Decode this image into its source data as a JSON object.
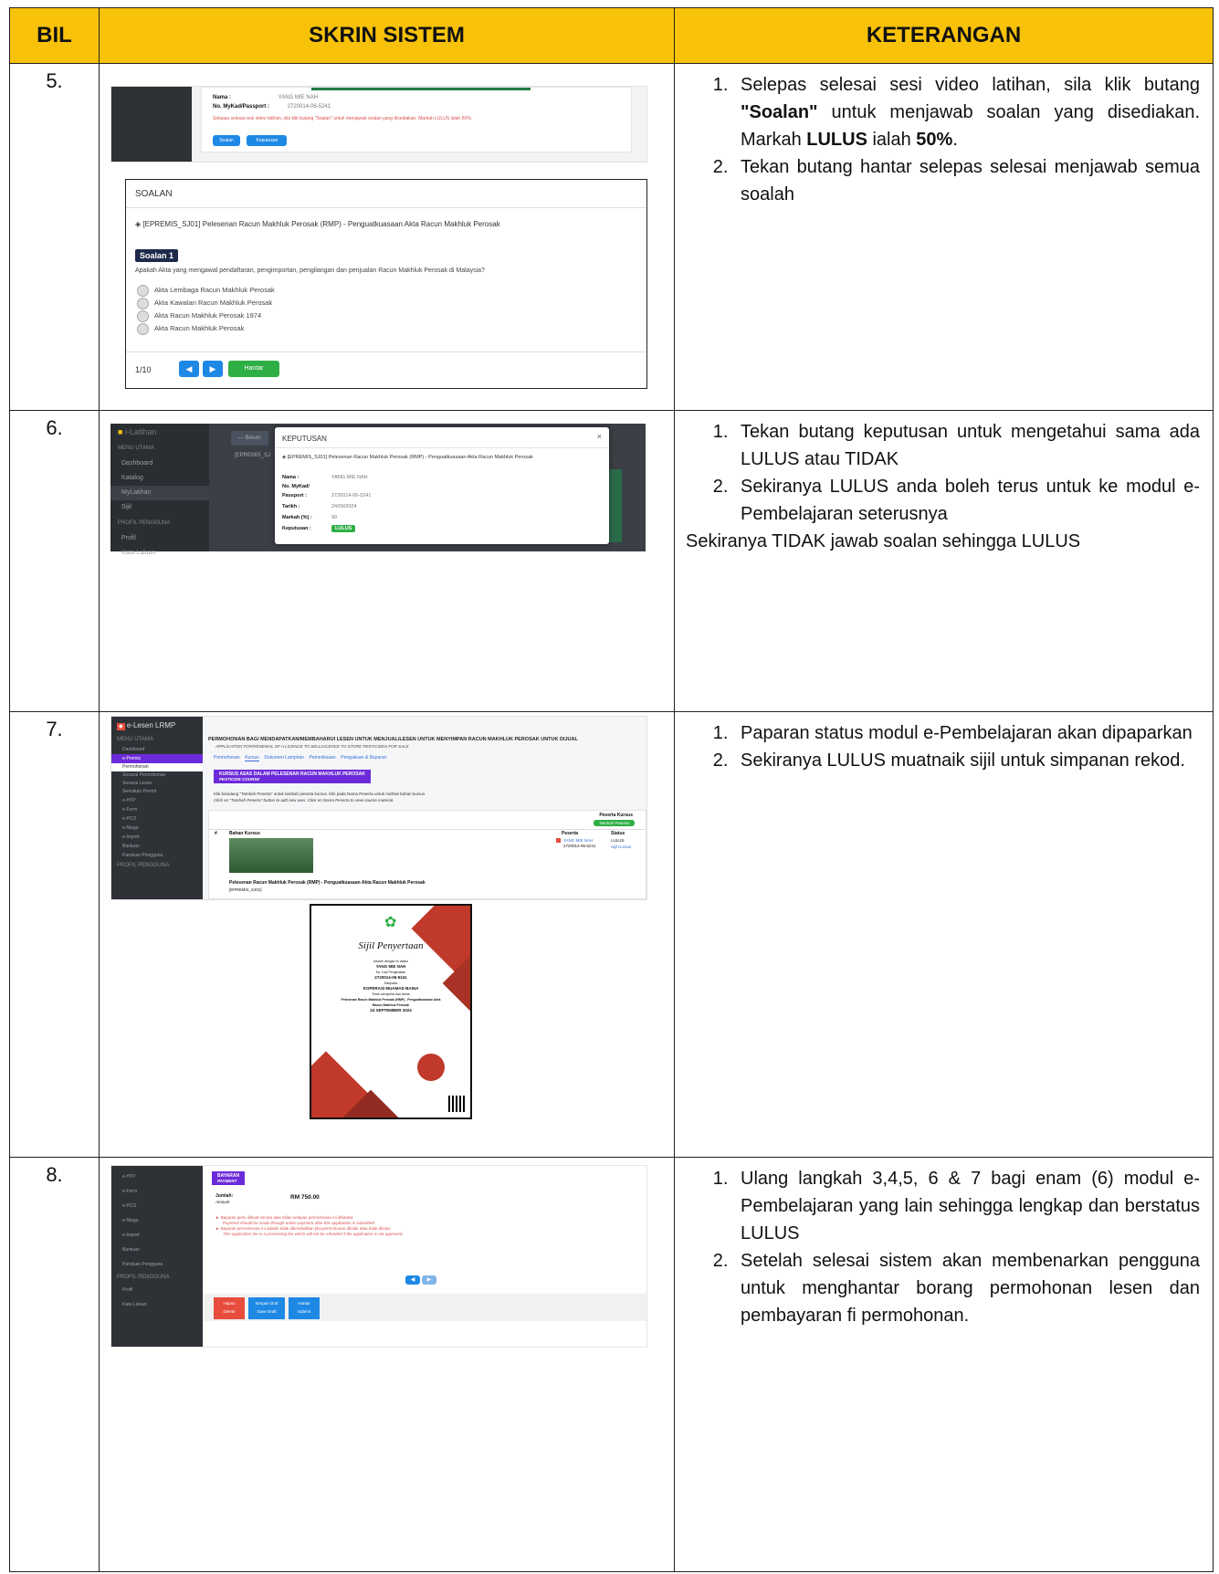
{
  "headers": {
    "bil": "BIL",
    "skrin": "SKRIN SISTEM",
    "keterangan": "KETERANGAN"
  },
  "rows": [
    {
      "bil": "5.",
      "items": [
        {
          "pre": "Selepas selesai sesi video latihan, sila klik butang ",
          "bold": "\"Soalan\"",
          "post": " untuk menjawab soalan yang disediakan. Markah ",
          "bold2": "LULUS",
          "post2": " ialah ",
          "bold3": "50%",
          "post3": "."
        },
        {
          "text": "Tekan butang hantar selepas selesai menjawab semua soalah"
        }
      ]
    },
    {
      "bil": "6.",
      "items": [
        {
          "text": "Tekan butang keputusan untuk mengetahui sama ada LULUS atau TIDAK"
        },
        {
          "text": "Sekiranya LULUS anda boleh terus untuk ke modul e-Pembelajaran seterusnya"
        }
      ],
      "extra": "Sekiranya TIDAK jawab soalan sehingga LULUS"
    },
    {
      "bil": "7.",
      "items": [
        {
          "text": "Paparan status modul e-Pembelajaran akan dipaparkan"
        },
        {
          "text": "Sekiranya LULUS muatnaik sijil untuk simpanan rekod."
        }
      ]
    },
    {
      "bil": "8.",
      "items": [
        {
          "text": "Ulang langkah 3,4,5, 6 & 7 bagi enam (6) modul e-Pembelajaran yang lain sehingga lengkap dan berstatus LULUS"
        },
        {
          "text": "Setelah selesai sistem akan membenarkan pengguna untuk menghantar borang permohonan lesen dan pembayaran fi permohonan."
        }
      ]
    }
  ],
  "shot5": {
    "nama_label": "Nama :",
    "nama_val": "YANG MIE NAH",
    "mykad_label": "No. MyKad/Passport :",
    "mykad_val": "2720014-06-5241",
    "notice": "Selepas selesai sesi video latihan, sila klik butang \"Soalan\" untuk menjawab soalan yang disediakan. Markah LULUS ialah 50%.",
    "btn_soalan": "Soalan",
    "btn_keputusan": "Keputusan",
    "soalan_title": "SOALAN",
    "course": "[EPREMIS_SJ01] Pelesenan Racun Makhluk Perosak (RMP) - Penguatkuasaan Akta Racun Makhluk Perosak",
    "soalan_badge": "Soalan 1",
    "question": "Apakah Akta yang mengawal pendaftaran, pengimportan, pengilangan dan penjualan Racun Makhluk Perosak di Malaysia?",
    "options": [
      "Akta Lembaga Racun Makhluk Perosak",
      "Akta Kawalan Racun Makhluk Perosak",
      "Akta Racun Makhluk Perosak 1974",
      "Akta Racun Makhluk Perosak"
    ],
    "page": "1/10",
    "btn_hantar": "Hantar"
  },
  "shot6": {
    "app": "i-Latihan",
    "menu_head": "MENU UTAMA",
    "menu": [
      "Dashboard",
      "Katalog",
      "MyLatihan",
      "Sijil"
    ],
    "profil_head": "PROFIL PENGGUNA",
    "profil": [
      "Profil",
      "Kata Laluan"
    ],
    "behind_btn": "— Belum",
    "behind_course": "[EPREMIS_SJ",
    "modal_title": "KEPUTUSAN",
    "modal_course": "[EPREMIS_SJ01] Pelesenan Racun Makhluk Perosak (RMP) - Penguatkuasaan Akta Racun Makhluk Perosak",
    "nama_label": "Nama :",
    "nama_val": "YANG MIE NAH",
    "mykad_label": "No. MyKad/ Passport :",
    "mykad_val": "2720014-06-5241",
    "tarikh_label": "Tarikh :",
    "tarikh_val": "24/09/2024",
    "markah_label": "Markah (%) :",
    "markah_val": "90",
    "keputusan_label": "Keputusan :",
    "keputusan_val": "LULUS",
    "close": "×"
  },
  "shot7": {
    "app": "e-Lesen LRMP",
    "menu_head": "MENU UTAMA",
    "menu": [
      "Dashboard",
      "e-Premis",
      "Permohonan",
      "Senarai Permohonan",
      "Senarai Lesen",
      "Semakan Permit",
      "e-HTP",
      "e-Form",
      "e-PCO",
      "e-Niaga",
      "e-Import",
      "Bantuan",
      "Panduan Pengguna"
    ],
    "profil_head": "PROFIL PENGGUNA",
    "heading": "PERMOHONAN BAGI MENDAPATKAN/MEMBAHARUI LESEN UNTUK MENJUAL/LESEN UNTUK MENYIMPAN RACUN MAKHLUK PEROSAK UNTUK DIJUAL",
    "subheading": "APPLICATION FOR/RENEWAL OF A LICENCE TO SELL/LICENCE TO STORE PESTICIDES FOR SALE",
    "tabs": [
      "Permohonan",
      "Kursus",
      "Dokumen Lampiran",
      "Pemeriksaan",
      "Pengakuan & Bayaran"
    ],
    "course_banner": "KURSUS ASAS DALAM PELESENAN RACUN MAKHLUK PEROSAK",
    "course_banner_en": "PESTICIDE COURSE",
    "instr1": "Klik betudang \"Tambah Peserta\" untuk tambah peserta kursus. Klik pada Nama Peserta untuk melihat bahan kursus.",
    "instr2": "Click on \"Tambah Peserta\" button to add new user. Click on Nama Peserta to view course material.",
    "peserta_title": "Peserta Kursus",
    "tambah_btn": "Tambah Peserta",
    "col_no": "#",
    "col_bahan": "Bahan Kursus",
    "col_peserta": "Peserta",
    "col_status": "Status",
    "peserta_name": "YANG MIE NAH",
    "peserta_ic": "2720014-06-5241",
    "status": "LULUS",
    "sijil_link": "Sijil Kursus",
    "course_name": "Pelesenan Racun Makhluk Perosak (RMP) - Penguatkuasaan Akta Racun Makhluk Perosak",
    "course_code": "[EPREMIS_SJ01]",
    "cert_title": "Sijil Penyertaan",
    "cert_lines": [
      "Adalah dengan ini diakui",
      "YANG MIE NAH",
      "No. Kad Pengenalan",
      "2720014-06-5241",
      "Daripada",
      "KOPERASI MUAMAD BAINA",
      "Telah menyertai dan tamat",
      "Pelesenan Racun Makhluk Perosak (RMP) - Penguatkuasaan Akta Racun Makhluk Perosak",
      "24 SEPTEMBER 2024"
    ]
  },
  "shot8": {
    "menu": [
      "e-HTP",
      "e-Form",
      "e-PCO",
      "e-Niaga",
      "e-Import",
      "Bantuan",
      "Panduan Pengguna"
    ],
    "profil_head": "PROFIL PENGGUNA",
    "profil": [
      "Profil",
      "Kata Laluan"
    ],
    "bayaran": "BAYARAN",
    "bayaran_en": "PAYMENT",
    "jumlah_label": "Jumlah:",
    "jumlah_en": "Amount",
    "jumlah_val": "RM 750.00",
    "note1": "Bayaran perlu dibuat secara atas talian selepas permohonan ini dihantar.",
    "note1_en": "Payment should be made through online payment after this application is submitted.",
    "note2": "Bayaran permohonan ini adalah tidak dikembalikan jika permohonan ditolak atau tidak dilulus.",
    "note2_en": "This application fee is a processing fee which will not be refunded if the application is not approved.",
    "btn_hapus": "Hapus",
    "btn_hapus_en": "Delete",
    "btn_simpan": "Simpan Draf",
    "btn_simpan_en": "Save Draft",
    "btn_hantar": "Hantar",
    "btn_hantar_en": "Submit"
  }
}
